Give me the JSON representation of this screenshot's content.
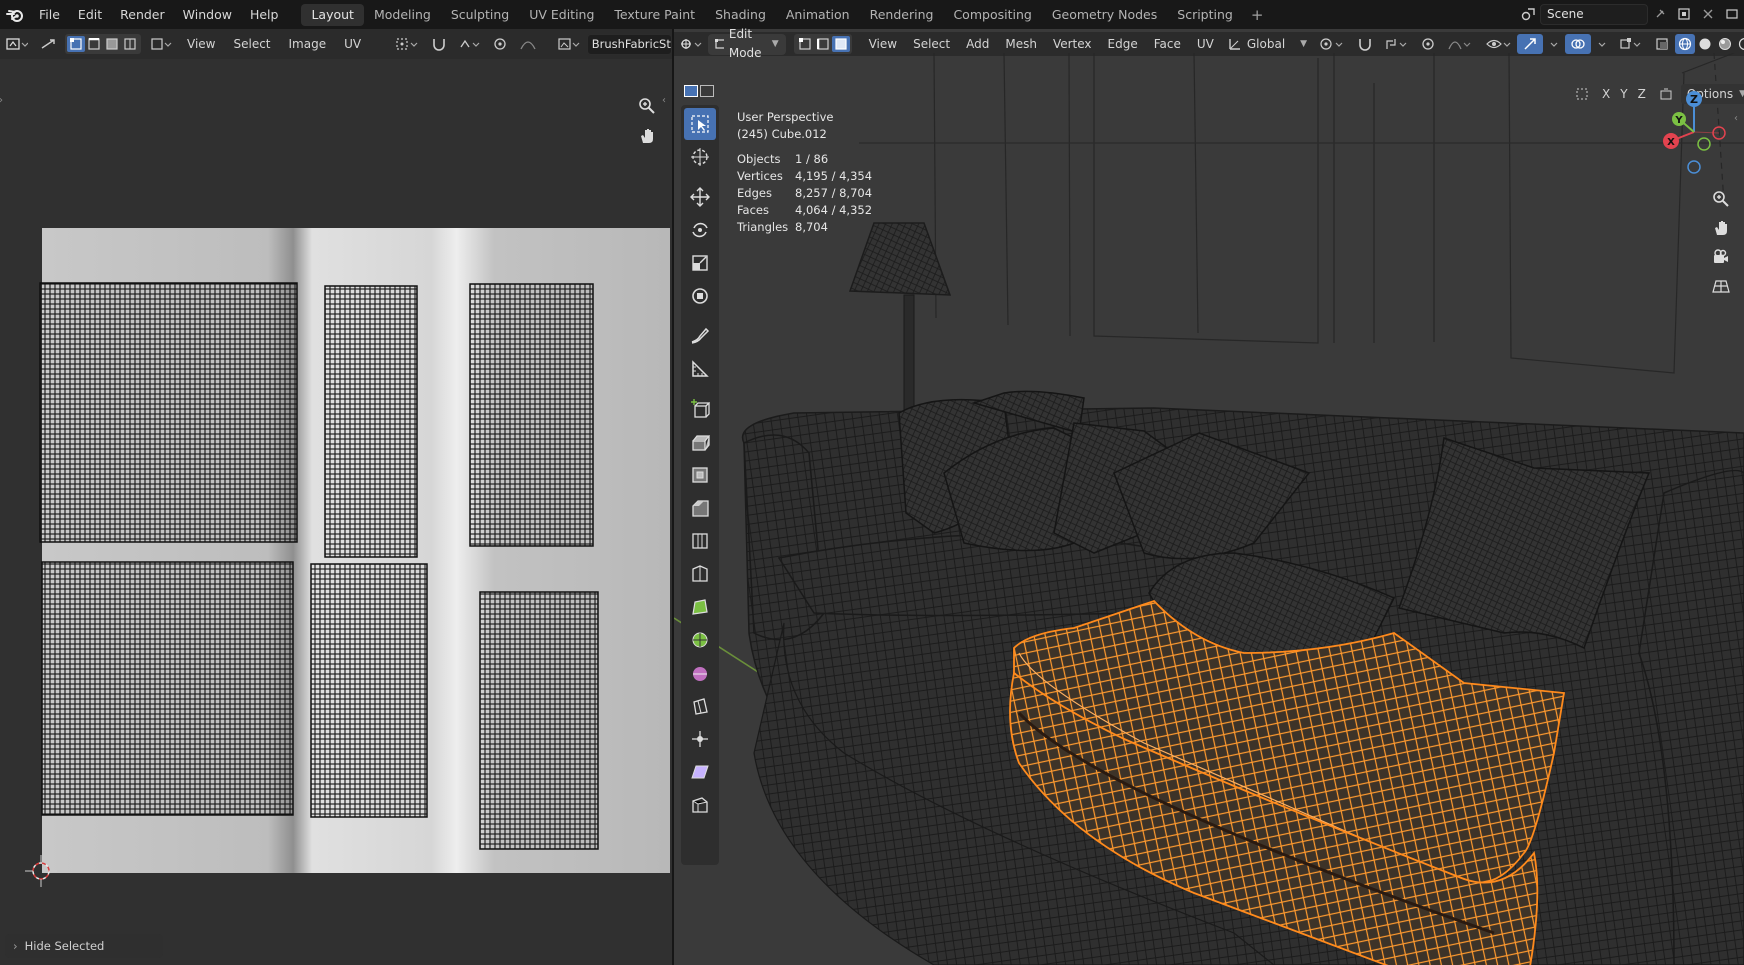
{
  "app_menu": [
    "File",
    "Edit",
    "Render",
    "Window",
    "Help"
  ],
  "workspace_tabs": [
    {
      "label": "Layout",
      "active": true
    },
    {
      "label": "Modeling"
    },
    {
      "label": "Sculpting"
    },
    {
      "label": "UV Editing"
    },
    {
      "label": "Texture Paint"
    },
    {
      "label": "Shading"
    },
    {
      "label": "Animation"
    },
    {
      "label": "Rendering"
    },
    {
      "label": "Compositing"
    },
    {
      "label": "Geometry Nodes"
    },
    {
      "label": "Scripting"
    }
  ],
  "scene": {
    "name": "Scene"
  },
  "uv_editor": {
    "menus": [
      "View",
      "Select",
      "Image",
      "UV"
    ],
    "image_name": "BrushFabricStitches…",
    "status_button": "Hide Selected"
  },
  "viewport": {
    "mode": "Edit Mode",
    "menus": [
      "View",
      "Select",
      "Add",
      "Mesh",
      "Vertex",
      "Edge",
      "Face",
      "UV"
    ],
    "orientation": "Global",
    "axes": [
      "X",
      "Y",
      "Z"
    ],
    "options_label": "Options",
    "overlay": {
      "perspective": "User Perspective",
      "object": "(245) Cube.012",
      "stats": [
        {
          "k": "Objects",
          "v": "1 / 86"
        },
        {
          "k": "Vertices",
          "v": "4,195 / 4,354"
        },
        {
          "k": "Edges",
          "v": "8,257 / 8,704"
        },
        {
          "k": "Faces",
          "v": "4,064 / 4,352"
        },
        {
          "k": "Triangles",
          "v": "8,704"
        }
      ]
    },
    "gizmo": {
      "x": "X",
      "y": "Y",
      "z": "Z"
    }
  },
  "colors": {
    "accent": "#4772b3",
    "selection": "#ff9a2e",
    "x_axis": "#e3434f",
    "y_axis": "#7bc043",
    "z_axis": "#4b8ed6"
  }
}
